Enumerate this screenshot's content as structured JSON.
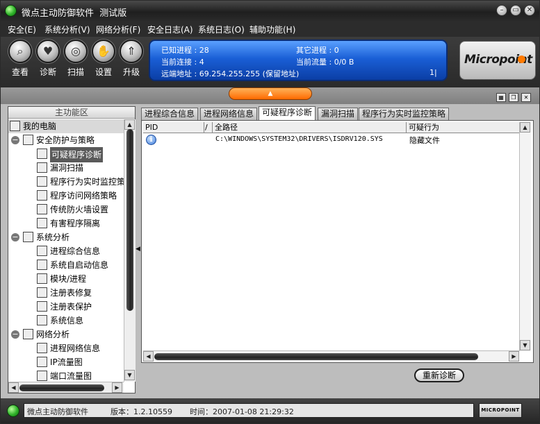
{
  "window": {
    "title": "微点主动防御软件  测试版",
    "controls": {
      "minimize": "–",
      "maximize": "▭",
      "close": "✕"
    }
  },
  "menu": [
    {
      "label": "安全(E)"
    },
    {
      "label": "系统分析(V)"
    },
    {
      "label": "网络分析(F)"
    },
    {
      "label": "安全日志(A)"
    },
    {
      "label": "系统日志(O)"
    },
    {
      "label": "辅助功能(H)"
    }
  ],
  "toolbar": [
    {
      "label": "查看",
      "icon": "magnifier-icon",
      "glyph": "⌕"
    },
    {
      "label": "诊断",
      "icon": "heartbeat-icon",
      "glyph": "♥"
    },
    {
      "label": "扫描",
      "icon": "scan-icon",
      "glyph": "◎"
    },
    {
      "label": "设置",
      "icon": "hand-icon",
      "glyph": "✋"
    },
    {
      "label": "升级",
      "icon": "upgrade-arrow-icon",
      "glyph": "⇑"
    }
  ],
  "status_panel": {
    "known_processes": "已知进程 : 28",
    "other_processes": "其它进程 : 0",
    "current_connections": "当前连接 : 4",
    "current_traffic": "当前流量 : 0/0 B",
    "remote_address": "远端地址 : 69.254.255.255 (保留地址)",
    "indicator": "1|"
  },
  "logo": {
    "text": "Micropoint"
  },
  "left_panel": {
    "header": "主功能区",
    "tree": [
      {
        "label": "我的电脑",
        "level": 0,
        "icon": "computer-icon",
        "root": true
      },
      {
        "label": "安全防护与策略",
        "level": 1,
        "icon": "shield-flag-icon",
        "toggle": "−"
      },
      {
        "label": "可疑程序诊断",
        "level": 2,
        "icon": "diagnose-icon",
        "selected": true
      },
      {
        "label": "漏洞扫描",
        "level": 2,
        "icon": "magnifier-icon"
      },
      {
        "label": "程序行为实时监控策略",
        "level": 2,
        "icon": "monitor-icon"
      },
      {
        "label": "程序访问网络策略",
        "level": 2,
        "icon": "network-policy-icon"
      },
      {
        "label": "传统防火墙设置",
        "level": 2,
        "icon": "firewall-icon"
      },
      {
        "label": "有害程序隔离",
        "level": 2,
        "icon": "hazard-icon"
      },
      {
        "label": "系统分析",
        "level": 1,
        "icon": "system-analysis-icon",
        "toggle": "−"
      },
      {
        "label": "进程综合信息",
        "level": 2,
        "icon": "process-info-icon"
      },
      {
        "label": "系统自启动信息",
        "level": 2,
        "icon": "autostart-icon"
      },
      {
        "label": "模块/进程",
        "level": 2,
        "icon": "module-icon"
      },
      {
        "label": "注册表修复",
        "level": 2,
        "icon": "registry-repair-icon"
      },
      {
        "label": "注册表保护",
        "level": 2,
        "icon": "registry-protect-icon"
      },
      {
        "label": "系统信息",
        "level": 2,
        "icon": "system-info-icon"
      },
      {
        "label": "网络分析",
        "level": 1,
        "icon": "network-analysis-icon",
        "toggle": "−"
      },
      {
        "label": "进程网络信息",
        "level": 2,
        "icon": "process-network-icon"
      },
      {
        "label": "IP流量图",
        "level": 2,
        "icon": "ip-traffic-icon"
      },
      {
        "label": "端口流量图",
        "level": 2,
        "icon": "port-traffic-icon"
      }
    ]
  },
  "tabs": [
    {
      "label": "进程综合信息"
    },
    {
      "label": "进程网络信息"
    },
    {
      "label": "可疑程序诊断",
      "active": true
    },
    {
      "label": "漏洞扫描"
    },
    {
      "label": "程序行为实时监控策略"
    }
  ],
  "list": {
    "columns": [
      "PID",
      "/",
      "全路径",
      "可疑行为"
    ],
    "rows": [
      {
        "pid": "",
        "path": "C:\\WINDOWS\\SYSTEM32\\DRIVERS\\ISDRV120.SYS",
        "behavior": "隐藏文件",
        "icon": "info-icon"
      }
    ]
  },
  "buttons": {
    "rediagnose": "重新诊断"
  },
  "statusbar": {
    "app_name": "微点主动防御软件",
    "version": "版本：1.2.10559",
    "time": "时间：2007-01-08 21:29:32",
    "logo_text": "MICROPOINT"
  },
  "colors": {
    "panel_blue": "#1a5fd6",
    "accent_orange": "#ff6a00",
    "status_green": "#2fb32a"
  }
}
